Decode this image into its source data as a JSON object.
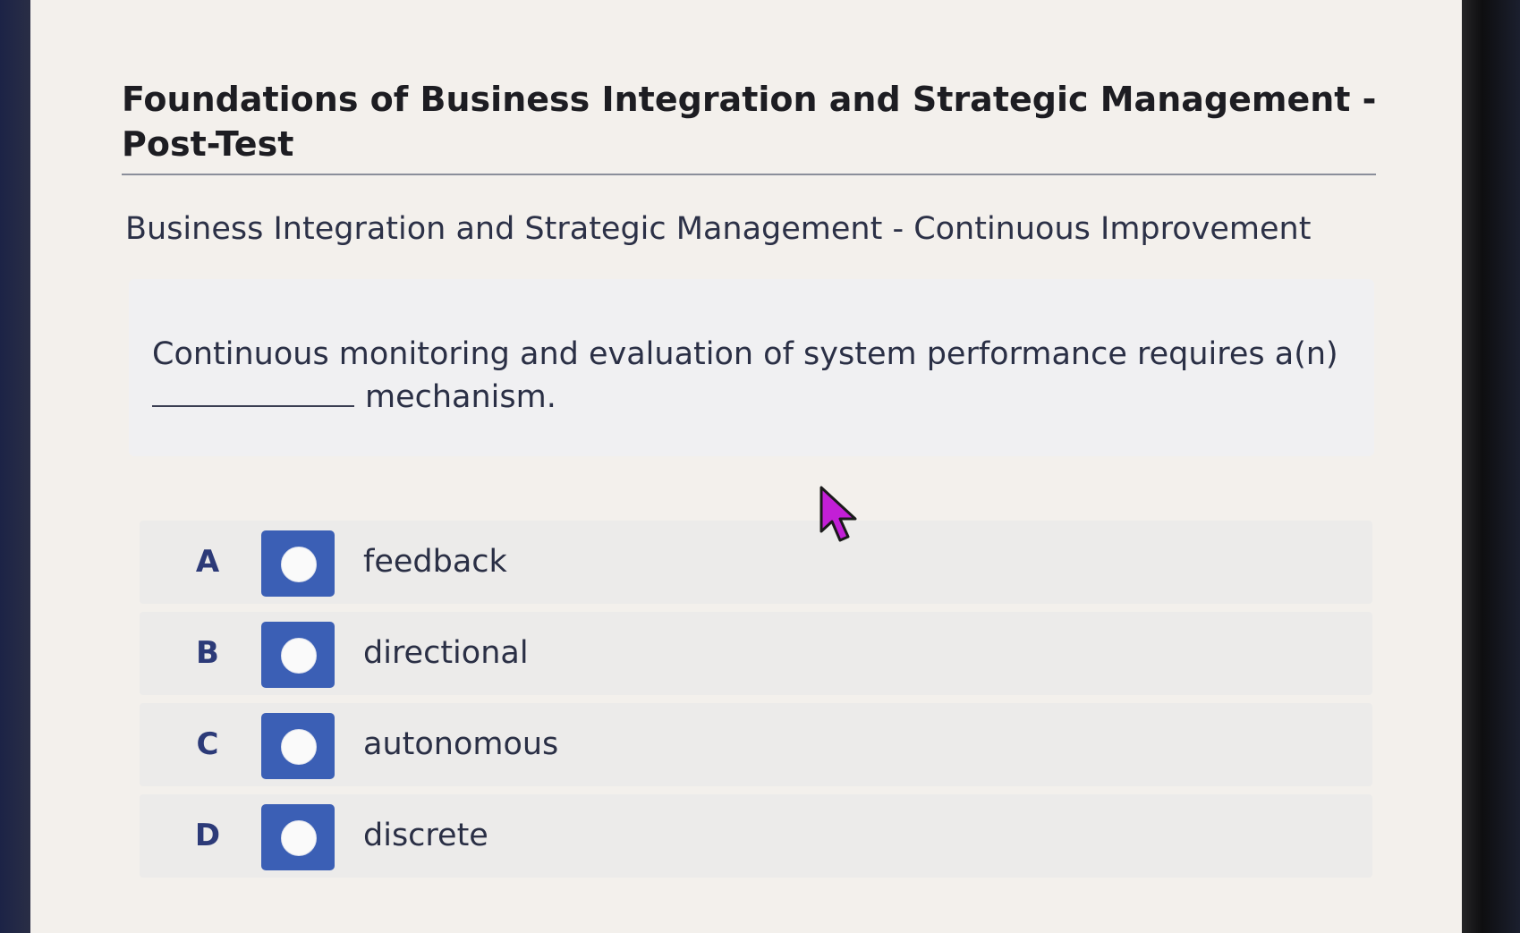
{
  "quiz": {
    "title": "Foundations of Business Integration and Strategic Management - Post-Test",
    "section": "Business Integration and Strategic Management - Continuous Improvement",
    "question": {
      "before_blank": "Continuous monitoring and evaluation of system performance requires a(n)",
      "after_blank": "mechanism."
    },
    "options": [
      {
        "letter": "A",
        "text": "feedback"
      },
      {
        "letter": "B",
        "text": "directional"
      },
      {
        "letter": "C",
        "text": "autonomous"
      },
      {
        "letter": "D",
        "text": "discrete"
      }
    ]
  },
  "colors": {
    "radio_button": "#3b5fb5",
    "letter": "#2c3a78",
    "cursor": "#c21fd6"
  },
  "icons": {
    "cursor": "mouse-pointer-icon",
    "radio": "radio-circle-icon"
  }
}
